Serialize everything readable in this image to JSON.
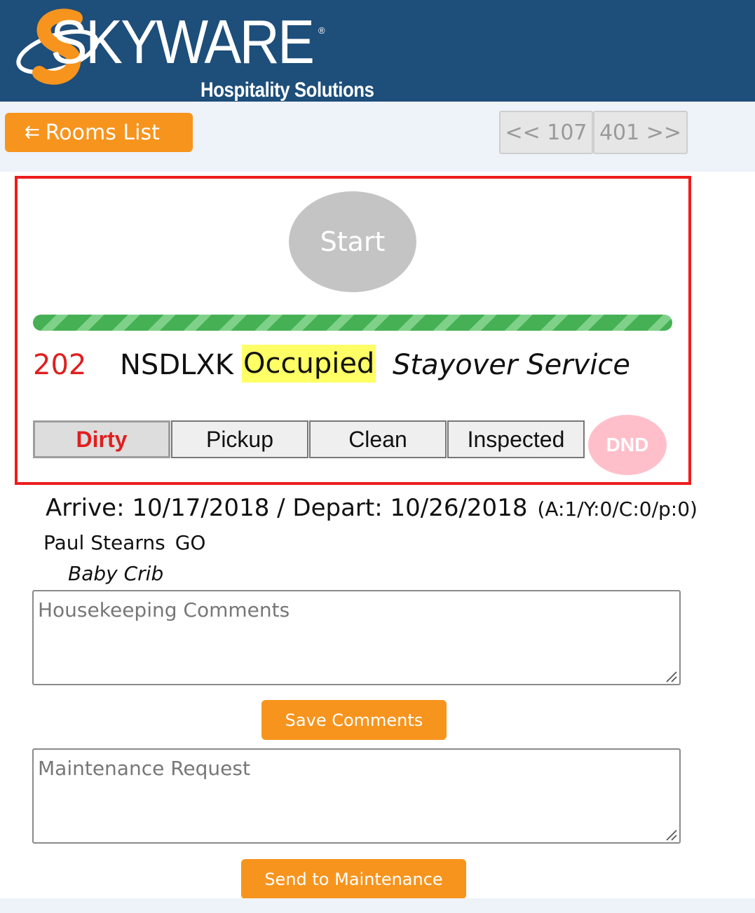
{
  "brand": {
    "logo_text": "SKYWARE",
    "registered_mark": "®",
    "subtitle": "Hospitality Solutions",
    "header_color": "#1e4e7a",
    "accent_orange": "#f7941d"
  },
  "toolbar": {
    "rooms_list_icon": "left-arrows-icon",
    "rooms_list_arrow": "⇇",
    "rooms_list_label": "Rooms List",
    "prev_room_label": "<< 107",
    "next_room_label": "401 >>"
  },
  "room": {
    "start_label": "Start",
    "progress_percent": 100,
    "number": "202",
    "code": "NSDLXK",
    "occupancy": "Occupied",
    "service": "Stayover Service",
    "statuses": [
      "Dirty",
      "Pickup",
      "Clean",
      "Inspected"
    ],
    "active_status": "Dirty",
    "dnd_label": "DND"
  },
  "stay": {
    "dates": "Arrive: 10/17/2018 / Depart: 10/26/2018",
    "counts": "(A:1/Y:0/C:0/p:0)",
    "guest_name": "Paul Stearns",
    "guest_code": "GO",
    "special_request": "Baby Crib"
  },
  "comments": {
    "placeholder": "Housekeeping Comments",
    "value": "",
    "save_label": "Save Comments"
  },
  "maintenance": {
    "placeholder": "Maintenance Request",
    "value": "",
    "send_label": "Send to Maintenance"
  }
}
